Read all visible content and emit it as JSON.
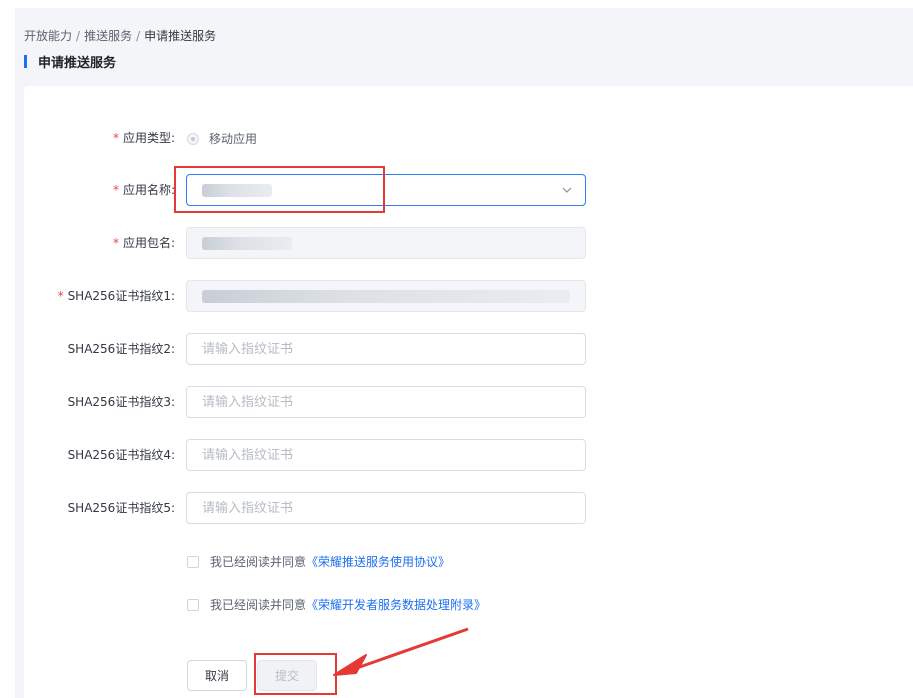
{
  "breadcrumb": {
    "items": [
      "开放能力",
      "推送服务",
      "申请推送服务"
    ],
    "separator": "/"
  },
  "page": {
    "title": "申请推送服务"
  },
  "form": {
    "required_mark": "*",
    "app_type": {
      "label": "应用类型:",
      "option": "移动应用"
    },
    "app_name": {
      "label": "应用名称:"
    },
    "package_name": {
      "label": "应用包名:"
    },
    "sha1": {
      "label": "SHA256证书指纹1:"
    },
    "sha2": {
      "label": "SHA256证书指纹2:",
      "placeholder": "请输入指纹证书"
    },
    "sha3": {
      "label": "SHA256证书指纹3:",
      "placeholder": "请输入指纹证书"
    },
    "sha4": {
      "label": "SHA256证书指纹4:",
      "placeholder": "请输入指纹证书"
    },
    "sha5": {
      "label": "SHA256证书指纹5:",
      "placeholder": "请输入指纹证书"
    },
    "agreement1": {
      "prefix": "我已经阅读并同意",
      "link": "《荣耀推送服务使用协议》"
    },
    "agreement2": {
      "prefix": "我已经阅读并同意",
      "link": "《荣耀开发者服务数据处理附录》"
    },
    "cancel_label": "取消",
    "submit_label": "提交"
  },
  "colors": {
    "accent": "#1e6ff0",
    "required": "#e5484d",
    "annotation": "#e53935"
  },
  "icons": {
    "dropdown": "chevron-down-icon"
  }
}
